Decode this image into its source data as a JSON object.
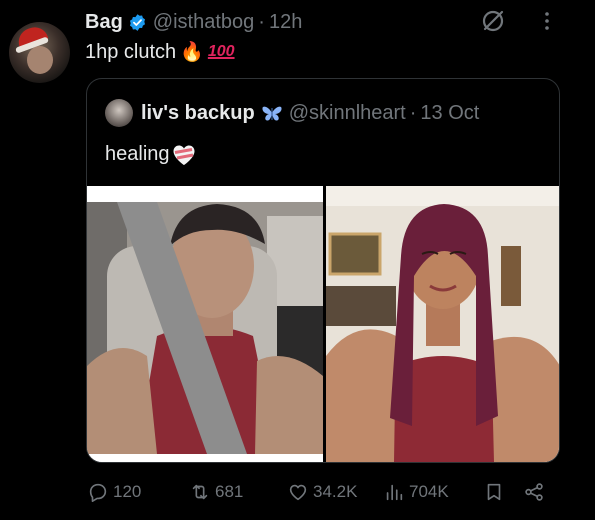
{
  "author": {
    "name": "Bag",
    "handle": "@isthatbog",
    "separator": "·",
    "time": "12h",
    "verified": true
  },
  "tweet": {
    "text": "1hp clutch",
    "emoji_fire": "🔥",
    "emoji_100": "100"
  },
  "quoted": {
    "name": "liv's backup",
    "handle": "@skinnlheart",
    "separator": "·",
    "date": "13 Oct",
    "text": "healing"
  },
  "actions": {
    "replies": "120",
    "retweets": "681",
    "likes": "34.2K",
    "views": "704K"
  },
  "icons": [
    "verified-icon",
    "grok-icon",
    "more-icon",
    "butterfly-icon",
    "heart-bandage-icon",
    "reply-icon",
    "retweet-icon",
    "like-icon",
    "views-icon",
    "bookmark-icon",
    "share-icon"
  ],
  "colors": {
    "background": "#000000",
    "text": "#e7e9ea",
    "muted": "#71767b",
    "border": "#2f3336",
    "verified": "#1d9bf0"
  }
}
